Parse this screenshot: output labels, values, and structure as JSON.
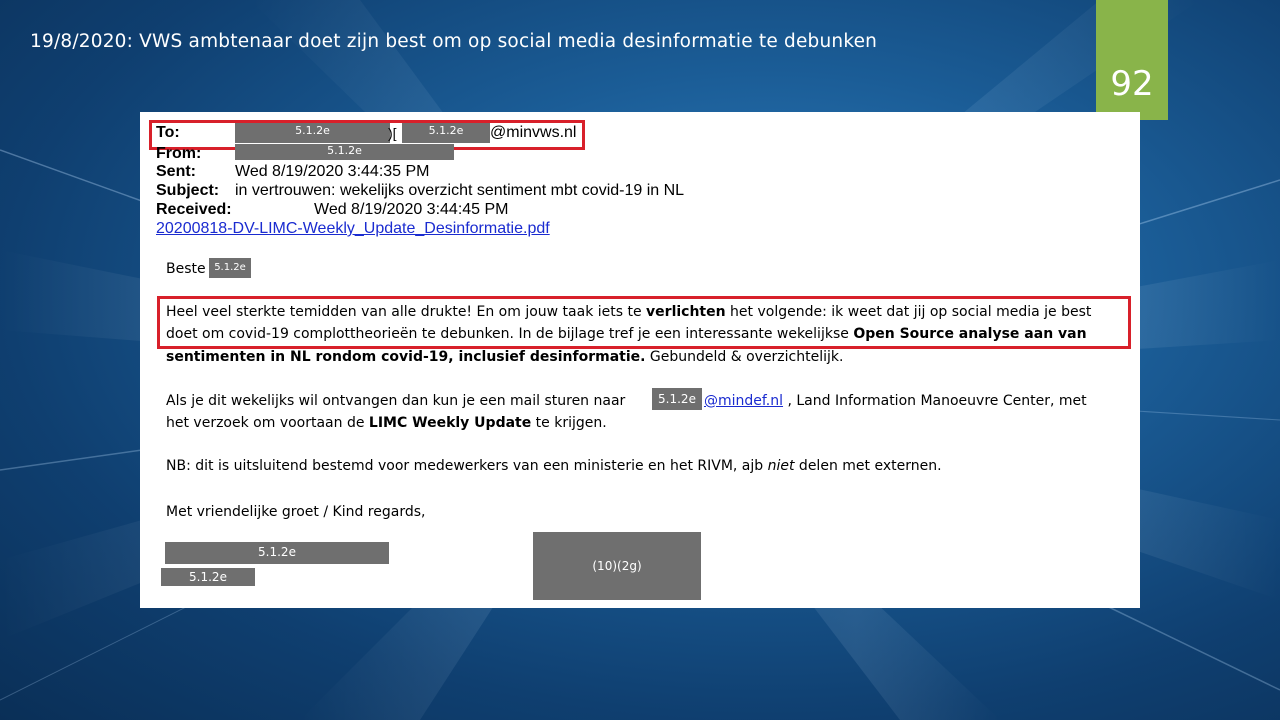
{
  "slide": {
    "title": "19/8/2020: VWS ambtenaar doet zijn best om op social media desinformatie te debunken",
    "page_number": "92",
    "accent_color": "#89b44a"
  },
  "email": {
    "to_label": "To:",
    "to_redact_1": "5.1.2e",
    "to_separator": ")[",
    "to_redact_2": "5.1.2e",
    "to_domain": "@minvws.nl",
    "from_label": "From:",
    "from_redact": "5.1.2e",
    "sent_label": "Sent:",
    "sent_value": "Wed 8/19/2020 3:44:35 PM",
    "subject_label": "Subject:",
    "subject_value": "in vertrouwen:  wekelijks overzicht sentiment mbt covid-19 in NL",
    "received_label": "Received:",
    "received_value": "Wed 8/19/2020 3:44:45 PM",
    "attachment": "20200818-DV-LIMC-Weekly_Update_Desinformatie.pdf",
    "greeting": "Beste",
    "greeting_redact": "5.1.2e",
    "p1_line1_a": "Heel veel sterkte temidden van alle drukte! En om jouw taak iets te ",
    "p1_line1_b": "verlichten",
    "p1_line1_c": " het volgende: ik weet dat jij op social media je best",
    "p1_line2_a": "doet om covid-19 complottheorieën te debunken. In de bijlage tref je een interessante wekelijkse ",
    "p1_line2_b": "Open Source analyse aan van",
    "p1_line3_a": "sentimenten in NL rondom covid-19, inclusief desinformatie.",
    "p1_line3_b": "  Gebundeld & overzichtelijk.",
    "p2_line1_a": "Als je dit wekelijks wil ontvangen dan kun je een mail sturen naar",
    "p2_redact": "5.1.2e",
    "p2_link": "@mindef.nl",
    "p2_line1_b": " , Land Information Manoeuvre Center, met",
    "p2_line2_a": "het verzoek om voortaan de ",
    "p2_line2_b": "LIMC Weekly Update",
    "p2_line2_c": " te krijgen.",
    "p3_a": "NB: dit is uitsluitend bestemd voor medewerkers van een ministerie en het RIVM, ajb ",
    "p3_b": "niet",
    "p3_c": " delen met externen.",
    "closing": "Met vriendelijke groet / Kind regards,",
    "sig_redact_1": "5.1.2e",
    "sig_redact_2": "5.1.2e",
    "sig_redact_3": "(10)(2g)"
  }
}
